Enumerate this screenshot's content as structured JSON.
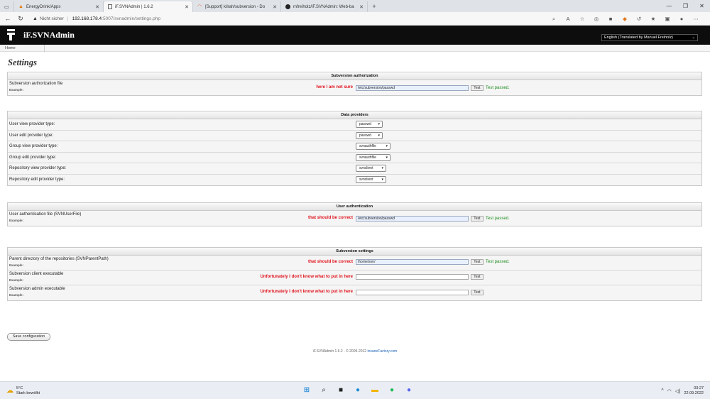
{
  "browser": {
    "tabs": [
      {
        "label": "EnergyDrink/Apps",
        "active": false
      },
      {
        "label": "iF.SVNAdmin | 1.6.2",
        "active": true
      },
      {
        "label": "[Support] kilrah/subversion - Do",
        "active": false
      },
      {
        "label": "mfreiholz/iF.SVNAdmin: Web-ba",
        "active": false
      }
    ],
    "new_tab": "+",
    "security_label": "Nicht sicher",
    "url_host": "192.168.178.4",
    "url_path": ":5007/svnadmin/settings.php",
    "window_controls": [
      "—",
      "❐",
      "✕"
    ]
  },
  "app": {
    "title": "iF.SVNAdmin",
    "language_selected": "English (Translated by Manuel Freiholz)",
    "breadcrumb": "Home",
    "page_title": "Settings"
  },
  "sections": {
    "auth": {
      "title": "Subversion authorization",
      "row": {
        "label": "Subversion authorization file",
        "example": "Example:",
        "note": "here I am not sure",
        "value": "/etc/subversion/passwd",
        "test": "Test",
        "result": "Test passed."
      }
    },
    "providers": {
      "title": "Data providers",
      "rows": [
        {
          "label": "User view provider type:",
          "value": "passwd"
        },
        {
          "label": "User edit provider type:",
          "value": "passwd"
        },
        {
          "label": "Group view provider type:",
          "value": "svnauthfile"
        },
        {
          "label": "Group edit provider type:",
          "value": "svnauthfile"
        },
        {
          "label": "Repository view provider type:",
          "value": "svnclient"
        },
        {
          "label": "Repository edit provider type:",
          "value": "svnclient"
        }
      ]
    },
    "userauth": {
      "title": "User authentication",
      "row": {
        "label": "User authentication file (SVNUserFile)",
        "example": "Example:",
        "note": "that should be correct",
        "value": "/etc/subversion/passwd",
        "test": "Test",
        "result": "Test passed."
      }
    },
    "svn": {
      "title": "Subversion settings",
      "rows": [
        {
          "label": "Parent directory of the repositories (SVNParentPath)",
          "example": "Example:",
          "note": "that should be correct",
          "value": "/home/svn/",
          "test": "Test",
          "result": "Test passed."
        },
        {
          "label": "Subversion client executable",
          "example": "Example:",
          "note": "Unfortunately I don't know what to put in here",
          "value": "",
          "test": "Test",
          "result": ""
        },
        {
          "label": "Subversion admin executable",
          "example": "Example:",
          "note": "Unfortunately I don't know what to put in here",
          "value": "",
          "test": "Test",
          "result": ""
        }
      ]
    }
  },
  "save_button": "Save configuration",
  "footer": {
    "text": "iF.SVNAdmin 1.6.2 - © 2009-2012 ",
    "link": "insaneFactory.com"
  },
  "taskbar": {
    "temperature": "5°C",
    "weather": "Stark bewölkt",
    "time": "03:27",
    "date": "22.09.2022"
  }
}
